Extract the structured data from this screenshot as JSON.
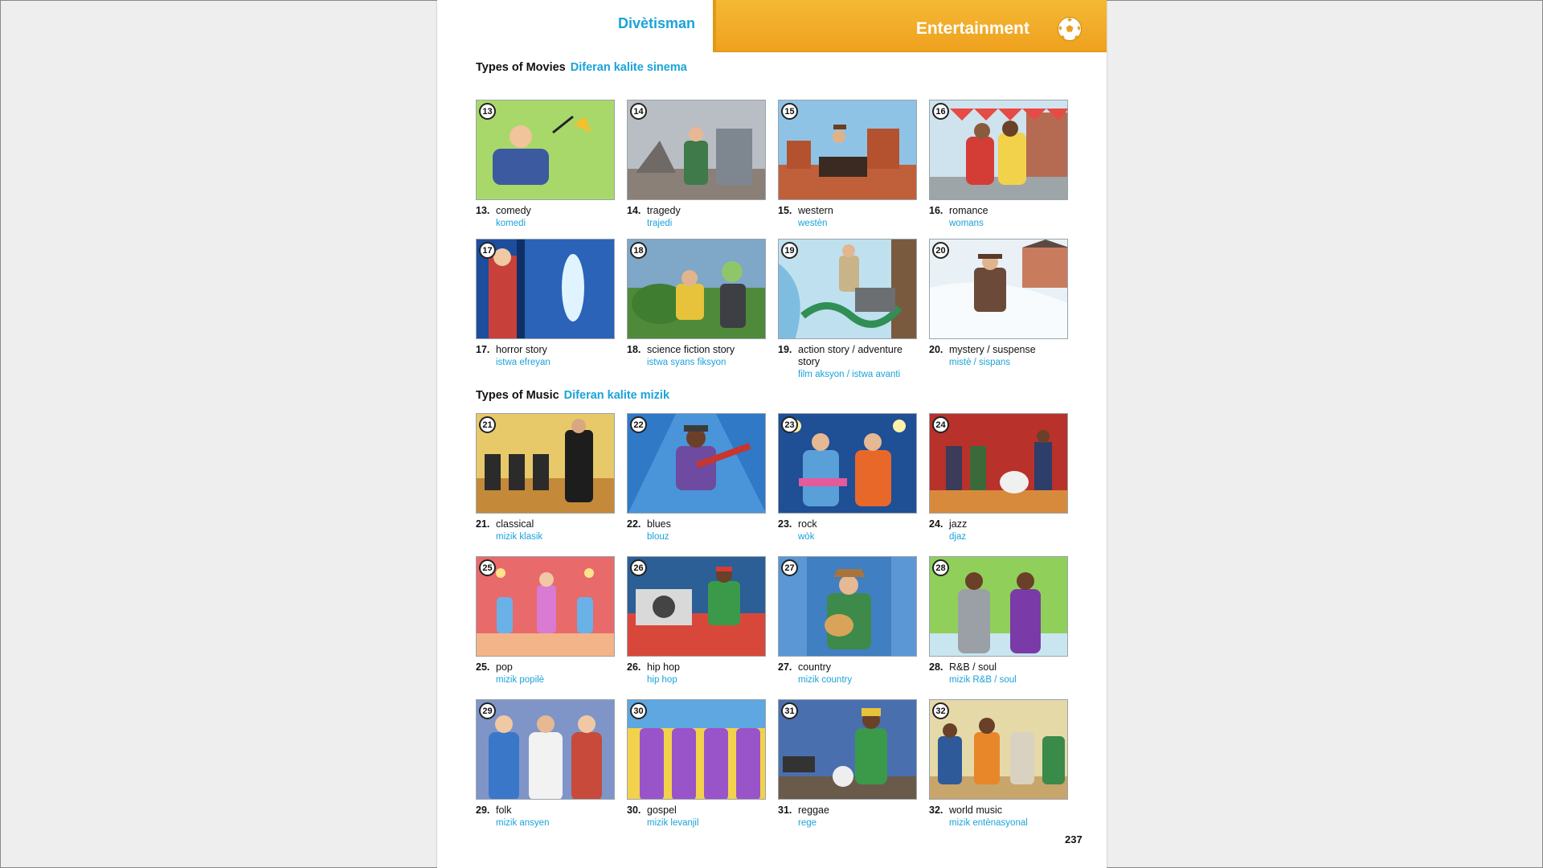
{
  "header": {
    "left_title": "Divètisman",
    "right_title": "Entertainment",
    "icon": "soccer-ball-icon",
    "accent_color": "#f1ac24",
    "blue_color": "#1aa3d9"
  },
  "movies": {
    "title": "Types of Movies",
    "subtitle": "Diferan kalite sinema",
    "items": [
      {
        "n": "13",
        "num": "13.",
        "en": "comedy",
        "ht": "komedi"
      },
      {
        "n": "14",
        "num": "14.",
        "en": "tragedy",
        "ht": "trajedi"
      },
      {
        "n": "15",
        "num": "15.",
        "en": "western",
        "ht": "westèn"
      },
      {
        "n": "16",
        "num": "16.",
        "en": "romance",
        "ht": "womans"
      },
      {
        "n": "17",
        "num": "17.",
        "en": "horror story",
        "ht": "istwa efreyan"
      },
      {
        "n": "18",
        "num": "18.",
        "en": "science fiction story",
        "ht": "istwa syans fiksyon"
      },
      {
        "n": "19",
        "num": "19.",
        "en": "action story / adventure story",
        "ht": "film aksyon / istwa avanti"
      },
      {
        "n": "20",
        "num": "20.",
        "en": "mystery / suspense",
        "ht": "mistè / sispans"
      }
    ]
  },
  "music": {
    "title": "Types of Music",
    "subtitle": "Diferan kalite mizik",
    "items": [
      {
        "n": "21",
        "num": "21.",
        "en": "classical",
        "ht": "mizik klasik"
      },
      {
        "n": "22",
        "num": "22.",
        "en": "blues",
        "ht": "blouz"
      },
      {
        "n": "23",
        "num": "23.",
        "en": "rock",
        "ht": "wòk"
      },
      {
        "n": "24",
        "num": "24.",
        "en": "jazz",
        "ht": "djaz"
      },
      {
        "n": "25",
        "num": "25.",
        "en": "pop",
        "ht": "mizik popilè"
      },
      {
        "n": "26",
        "num": "26.",
        "en": "hip hop",
        "ht": "hip hop"
      },
      {
        "n": "27",
        "num": "27.",
        "en": "country",
        "ht": "mizik country"
      },
      {
        "n": "28",
        "num": "28.",
        "en": "R&B / soul",
        "ht": "mizik R&B / soul"
      },
      {
        "n": "29",
        "num": "29.",
        "en": "folk",
        "ht": "mizik ansyen"
      },
      {
        "n": "30",
        "num": "30.",
        "en": "gospel",
        "ht": "mizik levanjil"
      },
      {
        "n": "31",
        "num": "31.",
        "en": "reggae",
        "ht": "rege"
      },
      {
        "n": "32",
        "num": "32.",
        "en": "world music",
        "ht": "mizik entènasyonal"
      }
    ]
  },
  "page_number": "237"
}
